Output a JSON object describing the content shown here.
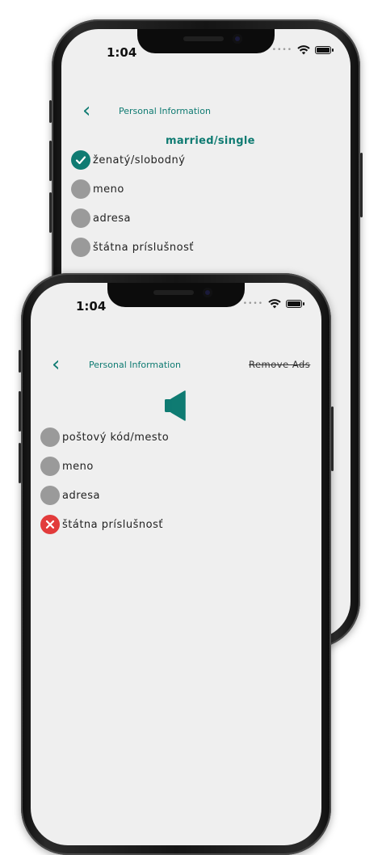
{
  "back_phone": {
    "time": "1:04",
    "nav_title": "Personal Information",
    "heading": "married/single",
    "options": [
      {
        "label": "ženatý/slobodný",
        "state": "correct"
      },
      {
        "label": "meno",
        "state": "none"
      },
      {
        "label": "adresa",
        "state": "none"
      },
      {
        "label": "štátna príslušnosť",
        "state": "none"
      }
    ]
  },
  "front_phone": {
    "time": "1:04",
    "nav_title": "Personal Information",
    "remove_ads": "Remove Ads",
    "speaker_icon": "speaker-icon",
    "options": [
      {
        "label": "poštový kód/mesto",
        "state": "none"
      },
      {
        "label": "meno",
        "state": "none"
      },
      {
        "label": "adresa",
        "state": "none"
      },
      {
        "label": "štátna príslušnosť",
        "state": "wrong"
      }
    ]
  },
  "colors": {
    "accent": "#0f7b72",
    "neutral": "#9a9a9a",
    "error": "#e23b3b",
    "screen_bg": "#efefef"
  }
}
